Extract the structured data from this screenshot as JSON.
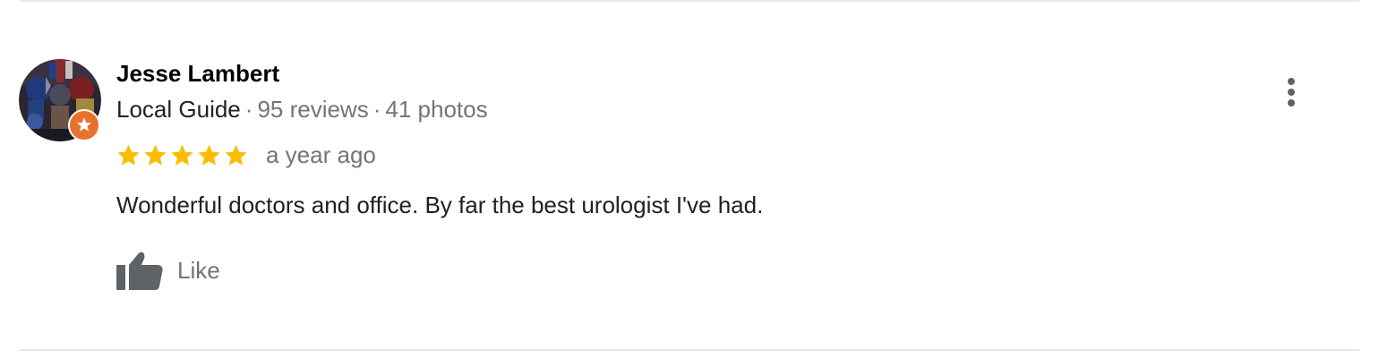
{
  "review": {
    "reviewer": {
      "name": "Jesse Lambert",
      "badge": "Local Guide",
      "separator": "·",
      "reviews": "95 reviews",
      "photos": "41 photos",
      "avatar_icon": "avatar-photo",
      "badge_icon": "local-guide-star-icon"
    },
    "rating": {
      "stars": 5,
      "max": 5,
      "star_color": "#fbbc04",
      "time": "a year ago"
    },
    "text": "Wonderful doctors and office. By far the best urologist I've had.",
    "actions": {
      "like_label": "Like",
      "like_icon": "thumbs-up-icon",
      "more_icon": "more-vert-icon"
    }
  },
  "colors": {
    "name": "#000000",
    "muted": "#70757a",
    "body": "#202124",
    "badge": "#e8712e",
    "icon": "#5f6368",
    "divider": "#e8e8e8"
  }
}
